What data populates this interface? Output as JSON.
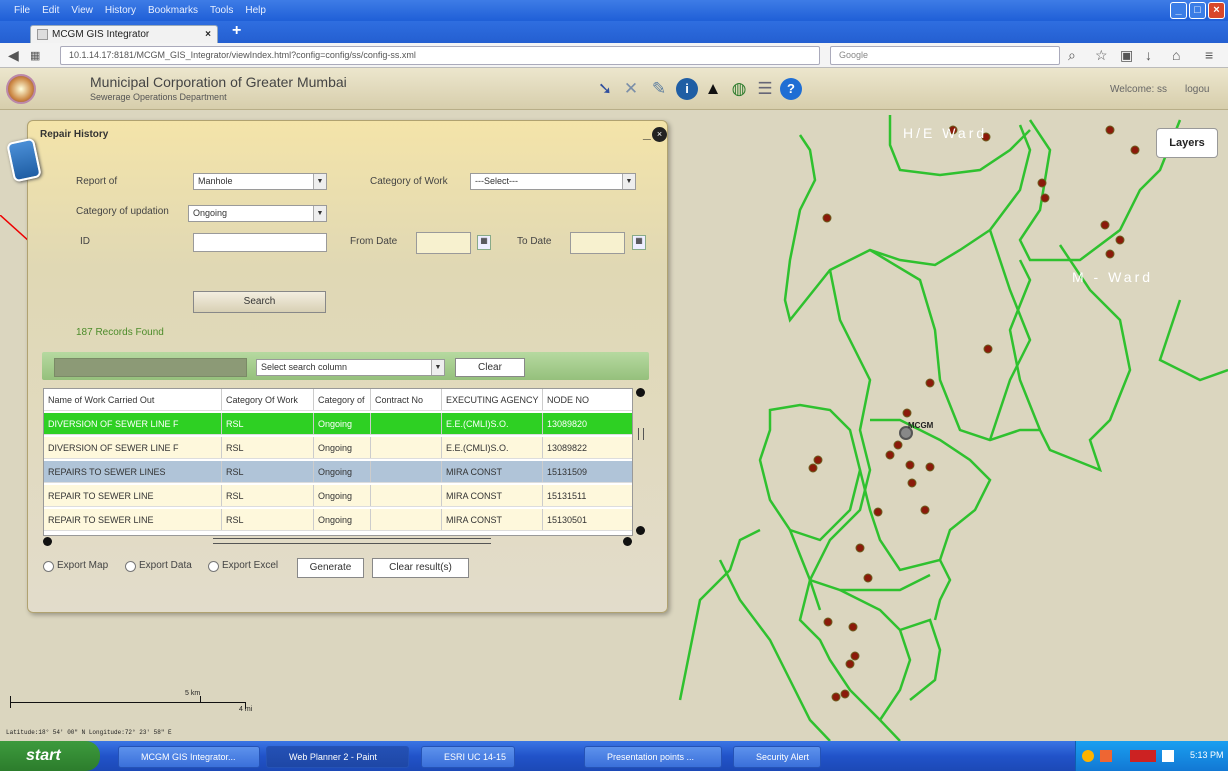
{
  "browser": {
    "menu": [
      "File",
      "Edit",
      "View",
      "History",
      "Bookmarks",
      "Tools",
      "Help"
    ],
    "tab_title": "MCGM GIS Integrator",
    "url": "10.1.14.17:8181/MCGM_GIS_Integrator/viewIndex.html?config=config/ss/config-ss.xml",
    "search_placeholder": "Google"
  },
  "header": {
    "title": "Municipal Corporation of Greater Mumbai",
    "subtitle": "Sewerage Operations Department",
    "welcome": "Welcome: ss",
    "logout": "logou"
  },
  "map": {
    "layers_label": "Layers",
    "ward_labels": [
      "H/E Ward",
      "M - Ward"
    ],
    "marker_label": "MCGM",
    "scale_5km": "5 km",
    "scale_4mi": "4 mi",
    "coords": "Latitude:18° 54' 00\" N  Longitude:72° 23' 58\" E"
  },
  "panel": {
    "title": "Repair History",
    "report_of_label": "Report of",
    "report_of_value": "Manhole",
    "category_work_label": "Category of Work",
    "category_work_value": "---Select---",
    "category_updation_label": "Category of updation",
    "category_updation_value": "Ongoing",
    "id_label": "ID",
    "from_date_label": "From Date",
    "to_date_label": "To Date",
    "search_button": "Search",
    "records_found": "187 Records Found",
    "search_column_value": "Select search column",
    "clear_button": "Clear",
    "columns": [
      "Name of Work Carried Out",
      "Category Of Work",
      "Category of",
      "Contract No",
      "EXECUTING AGENCY",
      "NODE NO"
    ],
    "rows": [
      [
        "DIVERSION OF SEWER LINE F",
        "RSL",
        "Ongoing",
        "",
        "E.E.(CMLI)S.O.",
        "13089820"
      ],
      [
        "DIVERSION OF SEWER LINE F",
        "RSL",
        "Ongoing",
        "",
        "E.E.(CMLI)S.O.",
        "13089822"
      ],
      [
        "REPAIRS TO SEWER LINES",
        "RSL",
        "Ongoing",
        "",
        "MIRA CONST",
        "15131509"
      ],
      [
        "REPAIR TO SEWER LINE",
        "RSL",
        "Ongoing",
        "",
        "MIRA CONST",
        "15131511"
      ],
      [
        "REPAIR TO SEWER LINE",
        "RSL",
        "Ongoing",
        "",
        "MIRA CONST",
        "15130501"
      ]
    ],
    "export_map": "Export Map",
    "export_data": "Export Data",
    "export_excel": "Export Excel",
    "generate_button": "Generate",
    "clear_results_button": "Clear result(s)"
  },
  "taskbar": {
    "start": "start",
    "tasks": [
      "MCGM GIS Integrator...",
      "Web Planner 2 - Paint",
      "ESRI UC 14-15",
      "Presentation points ...",
      "Security Alert"
    ],
    "clock": "5:13 PM"
  },
  "colors": {
    "ward_lines": "#2fc12f",
    "dots": "#8b1a0a",
    "selected_row": "#2ed023",
    "highlight_row": "#b0c4d8"
  }
}
